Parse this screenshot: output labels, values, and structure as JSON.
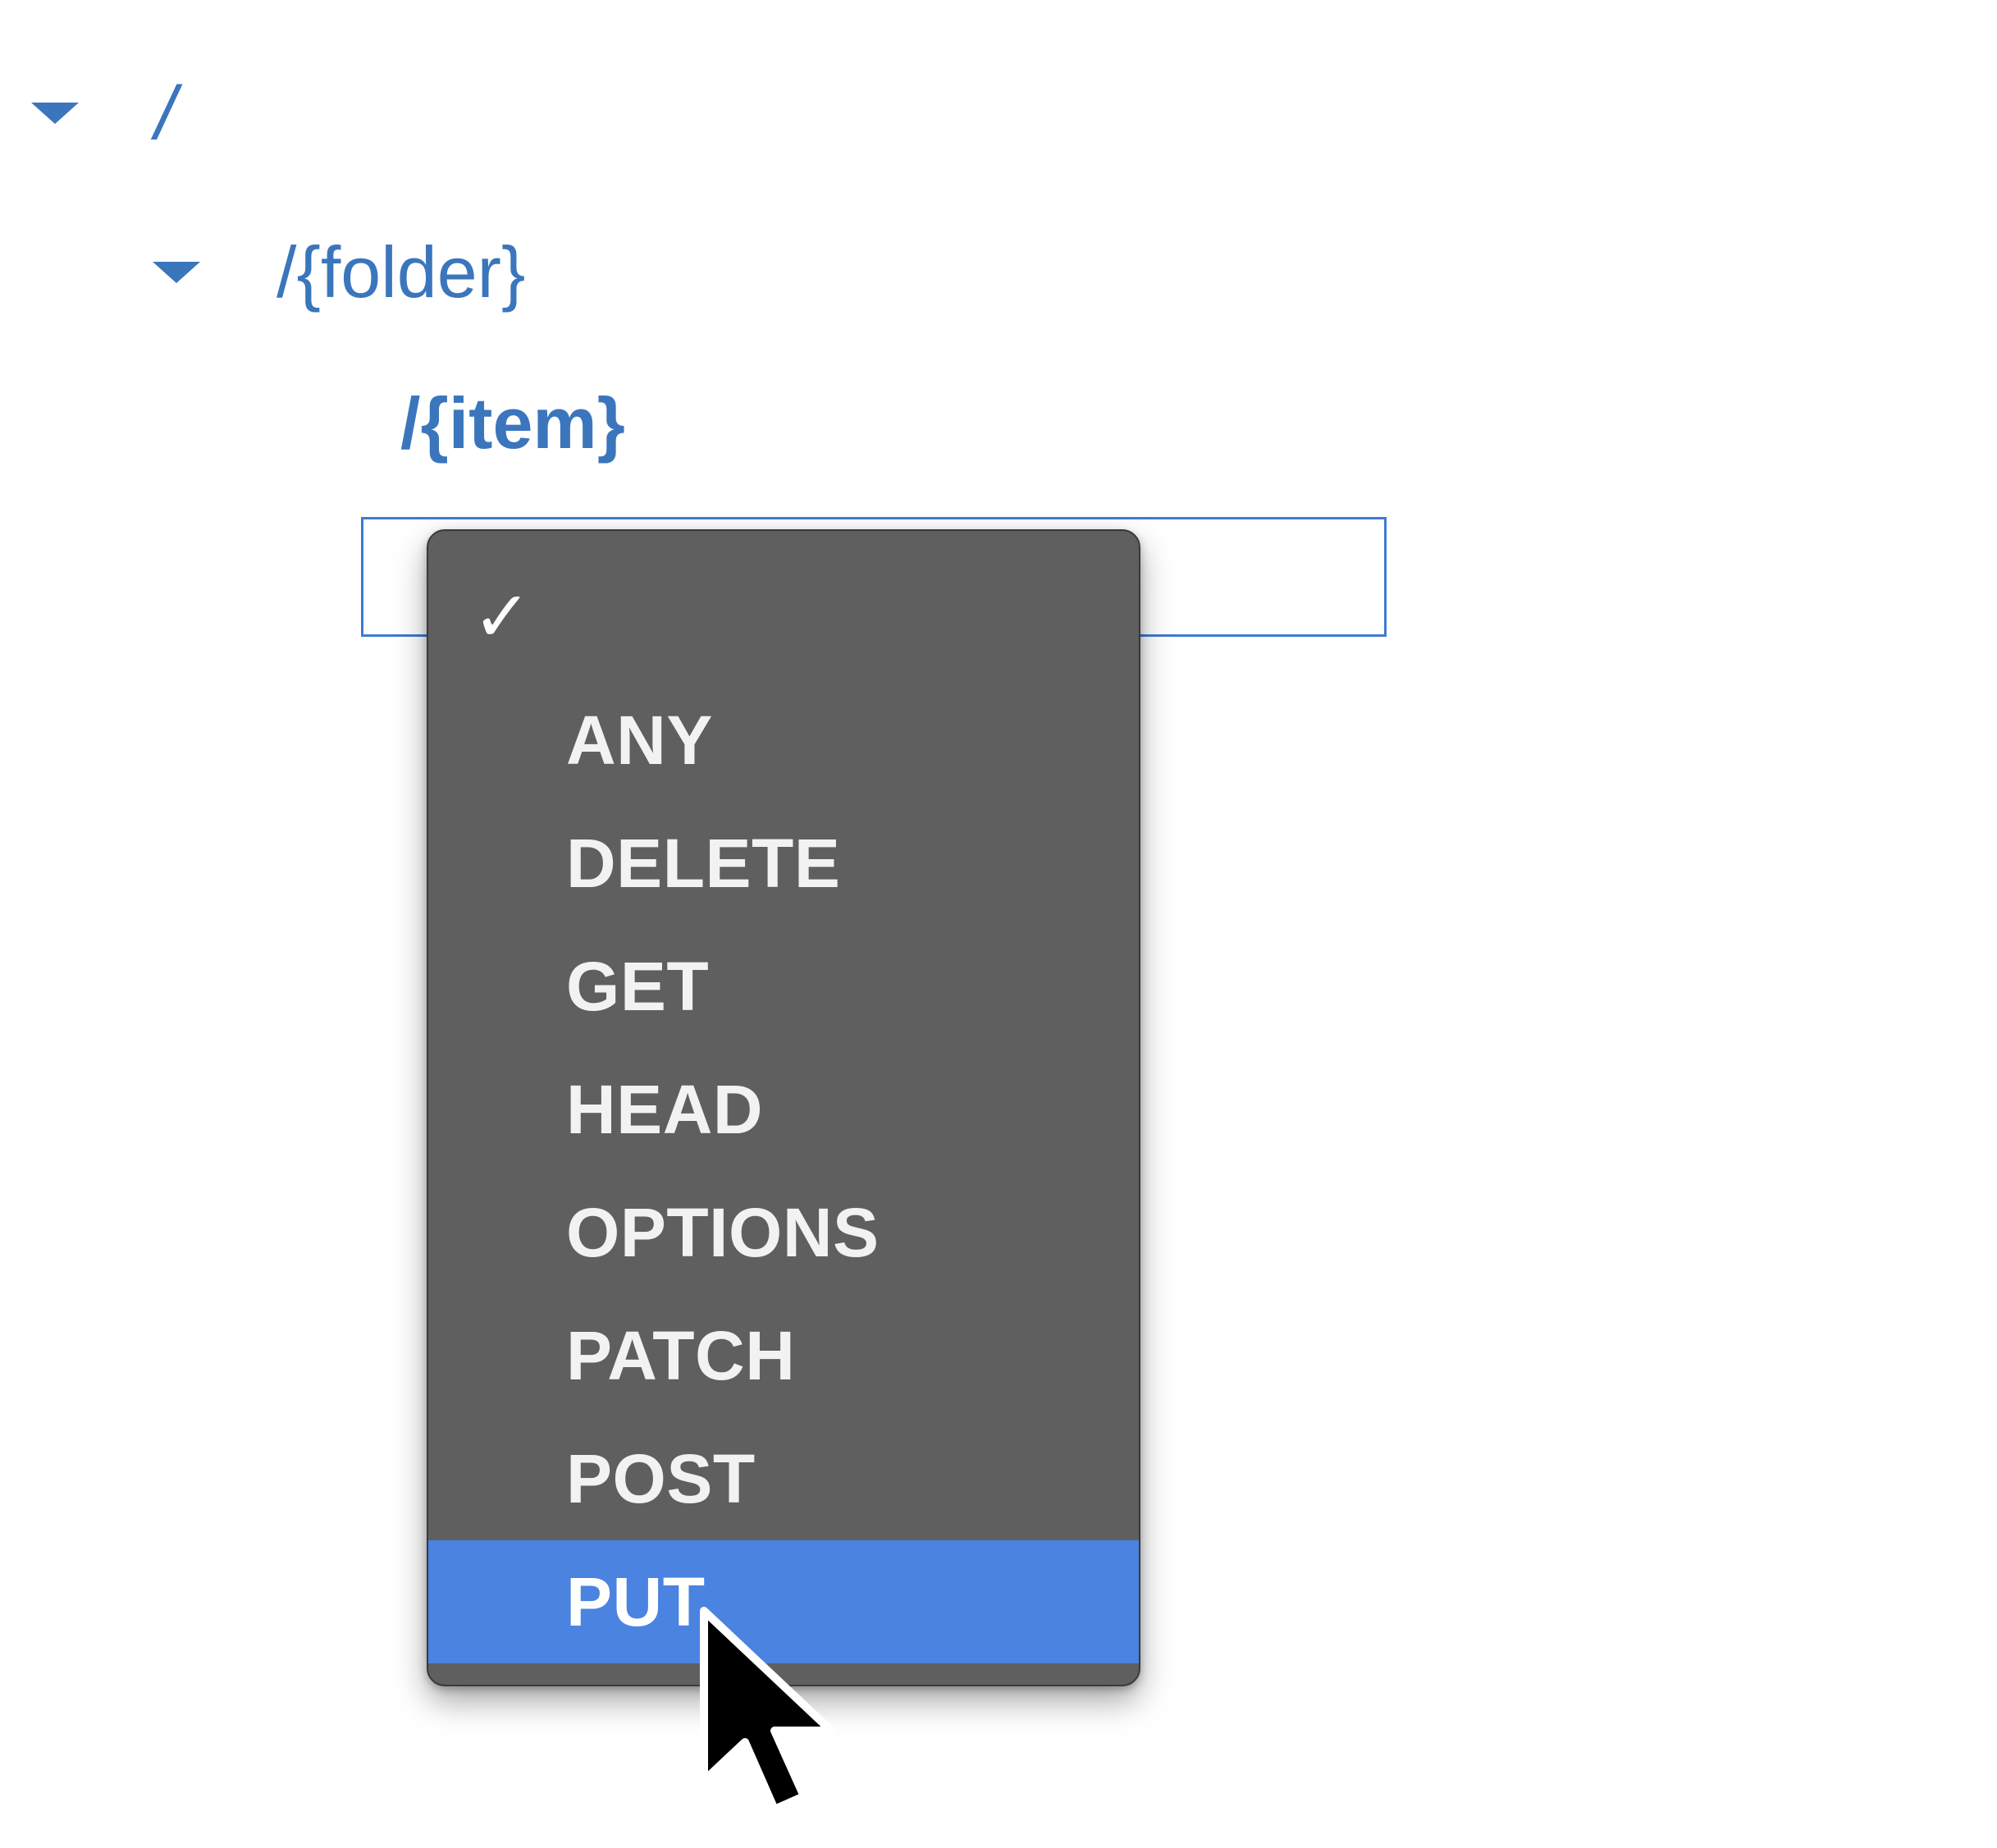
{
  "tree": {
    "root": {
      "label": "/",
      "expand_icon": "caret-down-icon"
    },
    "folder": {
      "label": "/{folder}",
      "expand_icon": "caret-down-icon"
    },
    "item": {
      "label": "/{item}"
    }
  },
  "method_select": {
    "current_value": "",
    "options": [
      {
        "label": "",
        "checked": true
      },
      {
        "label": "ANY"
      },
      {
        "label": "DELETE"
      },
      {
        "label": "GET"
      },
      {
        "label": "HEAD"
      },
      {
        "label": "OPTIONS"
      },
      {
        "label": "PATCH"
      },
      {
        "label": "POST"
      },
      {
        "label": "PUT",
        "highlighted": true
      }
    ],
    "check_icon": "checkmark-icon"
  },
  "colors": {
    "tree_text": "#3b76bd",
    "menu_background": "#5f5f5f",
    "highlight": "#4a83e0",
    "select_border": "#3f7bd0"
  },
  "cursor_icon": "arrow-pointer-icon"
}
